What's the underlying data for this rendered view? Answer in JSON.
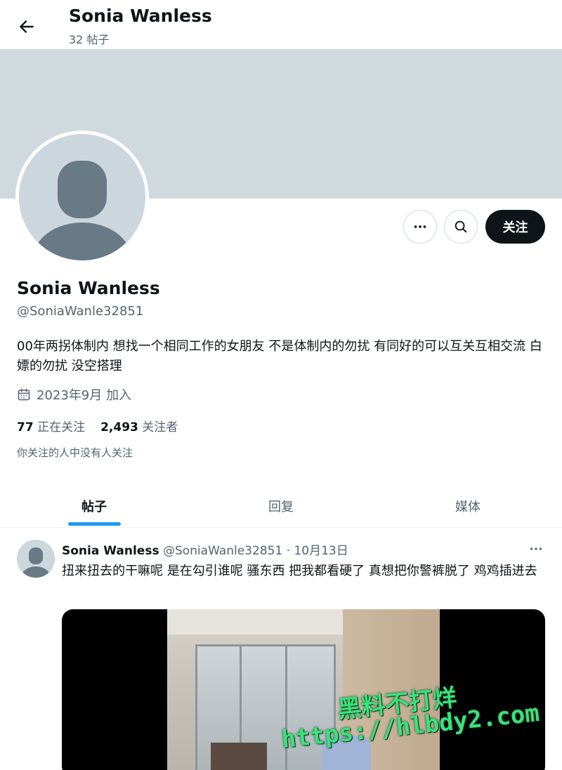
{
  "header": {
    "title": "Sonia Wanless",
    "post_count": "32 帖子"
  },
  "profile": {
    "name": "Sonia Wanless",
    "handle": "@SoniaWanle32851",
    "bio": "00年两拐体制内 想找一个相同工作的女朋友 不是体制内的勿扰 有同好的可以互关互相交流 白嫖的勿扰 没空搭理",
    "joined": "2023年9月 加入",
    "following_count": "77",
    "following_label": "正在关注",
    "followers_count": "2,493",
    "followers_label": "关注者",
    "followed_by": "你关注的人中没有人关注"
  },
  "actions": {
    "follow_label": "关注"
  },
  "tabs": [
    {
      "label": "帖子",
      "active": true
    },
    {
      "label": "回复",
      "active": false
    },
    {
      "label": "媒体",
      "active": false
    }
  ],
  "post": {
    "author": "Sonia Wanless",
    "meta": "@SoniaWanle32851 · 10月13日",
    "text": "扭来扭去的干嘛呢 是在勾引谁呢 骚东西 把我都看硬了 真想把你警裤脱了 鸡鸡插进去"
  },
  "watermark": {
    "line1": "黑料不打烊",
    "line2": "https://hlbdy2.com"
  },
  "colors": {
    "accent": "#1d9bf0",
    "banner": "#cfd9de",
    "follow_button": "#0f1419",
    "secondary_text": "#536471"
  },
  "icons": {
    "back": "arrow-left-icon",
    "more": "more-horizontal-icon",
    "search": "search-icon",
    "calendar": "calendar-icon"
  }
}
